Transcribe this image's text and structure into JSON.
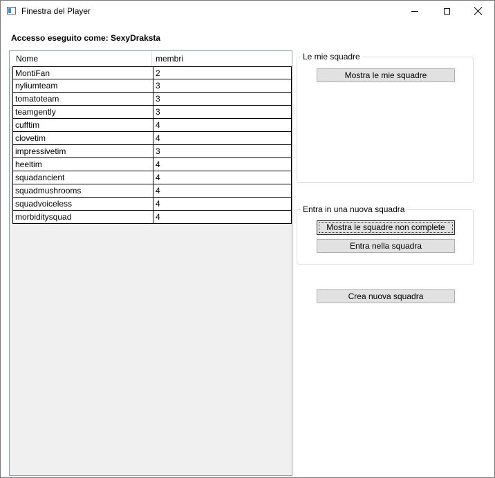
{
  "window": {
    "title": "Finestra del Player"
  },
  "login_label": "Accesso eseguito come: SexyDraksta",
  "teams_table": {
    "columns": [
      "Nome",
      "membri"
    ],
    "rows": [
      {
        "name": "MontiFan",
        "members": "2"
      },
      {
        "name": "nyliumteam",
        "members": "3"
      },
      {
        "name": "tomatoteam",
        "members": "3"
      },
      {
        "name": "teamgently",
        "members": "3"
      },
      {
        "name": "cufftim",
        "members": "4"
      },
      {
        "name": "clovetim",
        "members": "4"
      },
      {
        "name": "impressivetim",
        "members": "3"
      },
      {
        "name": "heeltim",
        "members": "4"
      },
      {
        "name": "squadancient",
        "members": "4"
      },
      {
        "name": "squadmushrooms",
        "members": "4"
      },
      {
        "name": "squadvoiceless",
        "members": "4"
      },
      {
        "name": "morbiditysquad",
        "members": "4"
      }
    ]
  },
  "my_teams_group": {
    "label": "Le mie squadre",
    "show_button": "Mostra le mie squadre"
  },
  "join_group": {
    "label": "Entra in una nuova squadra",
    "show_incomplete_button": "Mostra le squadre non complete",
    "join_button": "Entra nella squadra"
  },
  "create_button": "Crea nuova squadra",
  "icons": {
    "app": "window-app-icon",
    "minimize": "minimize-icon",
    "maximize": "maximize-icon",
    "close": "close-icon"
  }
}
